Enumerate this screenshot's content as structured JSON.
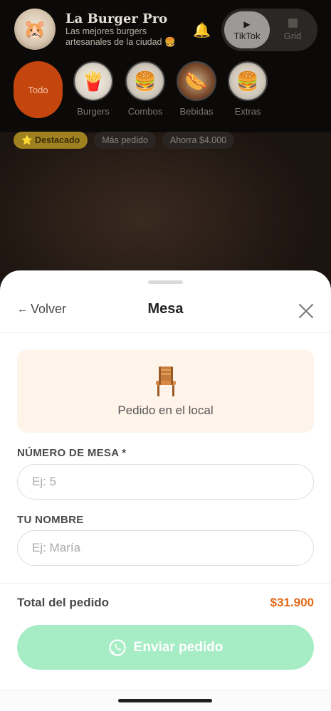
{
  "header": {
    "brand_title": "La Burger Pro",
    "brand_subtitle": "Las mejores burgers artesanales de la ciudad 🍔",
    "view_toggle": {
      "tiktok_label": "TikTok",
      "grid_label": "Grid",
      "selected": "TikTok"
    }
  },
  "categories": [
    {
      "label": "Todo",
      "active": true
    },
    {
      "label": "Burgers",
      "icon": "fries-image"
    },
    {
      "label": "Combos",
      "icon": "burger-image"
    },
    {
      "label": "Bebidas",
      "icon": "hotdog-image"
    },
    {
      "label": "Extras",
      "icon": "burger-image"
    }
  ],
  "tags": {
    "featured": "⭐ Destacado",
    "popular": "Más pedido",
    "savings": "Ahorra $4.000"
  },
  "sheet": {
    "back_label": "Volver",
    "title": "Mesa",
    "local_card_label": "Pedido en el local",
    "table_number_label": "NÚMERO DE MESA *",
    "table_number_placeholder": "Ej: 5",
    "table_number_value": "",
    "name_label": "TU NOMBRE",
    "name_placeholder": "Ej: María",
    "name_value": "",
    "total_label": "Total del pedido",
    "total_value": "$31.900",
    "send_label": "Enviar pedido"
  },
  "colors": {
    "accent_orange": "#e36a1a",
    "send_button": "#a6ecc4",
    "active_category": "#c4460e",
    "featured_tag": "#a08120"
  }
}
